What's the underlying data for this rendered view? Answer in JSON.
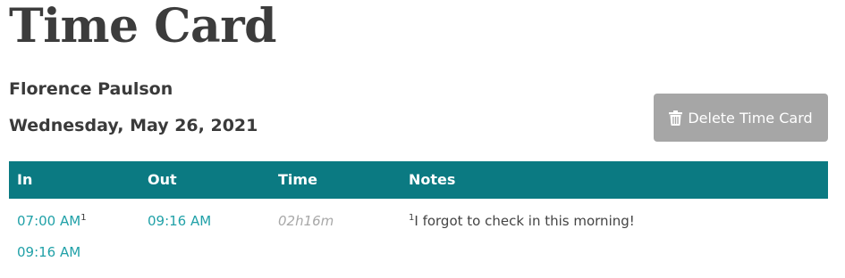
{
  "page": {
    "title": "Time Card",
    "employee_name": "Florence Paulson",
    "date": "Wednesday, May 26, 2021"
  },
  "actions": {
    "delete_label": "Delete Time Card",
    "delete_icon": "trash-icon",
    "delete_color": "#a6a6a6"
  },
  "table": {
    "header_color": "#0b7a82",
    "link_color": "#21a1a8",
    "columns": [
      "In",
      "Out",
      "Time",
      "Notes"
    ],
    "rows": [
      {
        "in": [
          "07:00 AM",
          "09:16 AM"
        ],
        "in_footnote": "1",
        "out": "09:16 AM",
        "time": "02h16m",
        "note_marker": "1",
        "note": "I forgot to check in this morning!"
      }
    ]
  }
}
